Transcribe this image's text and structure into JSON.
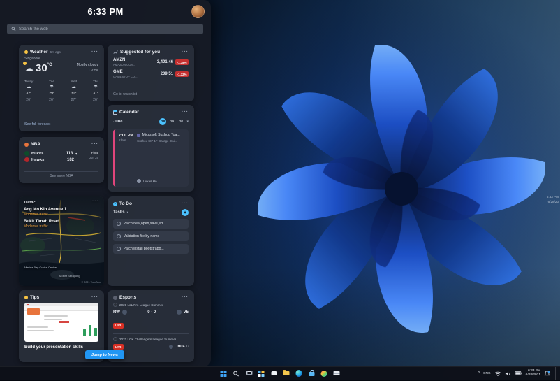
{
  "glyphs": {
    "ellipsis": "···",
    "chevron_down": "▾",
    "plus": "+",
    "check": "✓",
    "caret_up": "^",
    "winner_arrow": "◀",
    "down_arrow": "↓"
  },
  "desktop": {
    "edge_time": "6:33 PM",
    "edge_date": "6/28/20"
  },
  "panel": {
    "clock": "6:33 PM",
    "search_placeholder": "Search the web",
    "jump_button": "Jump to News",
    "weather": {
      "title": "Weather",
      "updated": "6m ago",
      "location": "Singapore",
      "icon": "☁",
      "temp": "30",
      "unit": "°C",
      "condition": "Mostly cloudy",
      "precipitation": "22%",
      "forecast": [
        {
          "day": "Today",
          "icon": "☁",
          "hi": "32°",
          "lo": "26°"
        },
        {
          "day": "Tue",
          "icon": "☂",
          "hi": "29°",
          "lo": "26°"
        },
        {
          "day": "Wed",
          "icon": "☁",
          "hi": "31°",
          "lo": "27°"
        },
        {
          "day": "Thu",
          "icon": "☂",
          "hi": "31°",
          "lo": "26°"
        }
      ],
      "footer": "See full forecast"
    },
    "stocks": {
      "title": "Suggested for you",
      "items": [
        {
          "symbol": "AMZN",
          "name": "AMAZON.COM...",
          "price": "3,401.46",
          "change": "-1.38%"
        },
        {
          "symbol": "GME",
          "name": "GAMESTOP CO...",
          "price": "209.51",
          "change": "-1.32%"
        }
      ],
      "footer": "Go to watchlist"
    },
    "calendar": {
      "title": "Calendar",
      "month": "June",
      "days": [
        "28",
        "29",
        "30"
      ],
      "event": {
        "time": "7:00 PM",
        "duration": "2 hrs",
        "title": "Microsoft Suzhou Toa...",
        "location": "Suzhou SIP 1F Garage (Bui...",
        "attendee": "Lukas Ho"
      }
    },
    "nba": {
      "title": "NBA",
      "status": "Final",
      "date": "Jun 25",
      "teams": [
        {
          "name": "Bucks",
          "score": "113"
        },
        {
          "name": "Hawks",
          "score": "102"
        }
      ],
      "footer": "See more NBA"
    },
    "traffic": {
      "title": "Traffic",
      "routes": [
        {
          "road": "Ang Mo Kio Avenue 1",
          "status": "Moderate traffic"
        },
        {
          "road": "Bukit Timah Road",
          "status": "Moderate traffic"
        }
      ],
      "labels": [
        "Marina Bay Cruise Centre",
        "Mount Serapong"
      ],
      "attribution": "© 2021 TomTom"
    },
    "todo": {
      "title": "To Do",
      "list": "Tasks",
      "tasks": [
        "Patch new,open,save,edi...",
        "Validation file by name",
        "Patch install bootstrapp..."
      ]
    },
    "tips": {
      "title": "Tips",
      "headline": "Build your presentation skills"
    },
    "esports": {
      "title": "Esports",
      "matches": [
        {
          "league": "2021 LoL Pro League Summer",
          "team1": "RW",
          "score": "0 - 0",
          "team2": "V5",
          "status": "LIVE"
        },
        {
          "league": "2021 LCK Challengers League Summer",
          "status": "LIVE",
          "team": "HLE.C"
        }
      ]
    }
  },
  "taskbar": {
    "icons": [
      "start",
      "search",
      "task-view",
      "widgets",
      "chat",
      "file-explorer",
      "edge",
      "store",
      "photos",
      "mail"
    ],
    "tray": {
      "lang": "ENG",
      "time": "6:33 PM",
      "date": "6/28/2021"
    }
  }
}
